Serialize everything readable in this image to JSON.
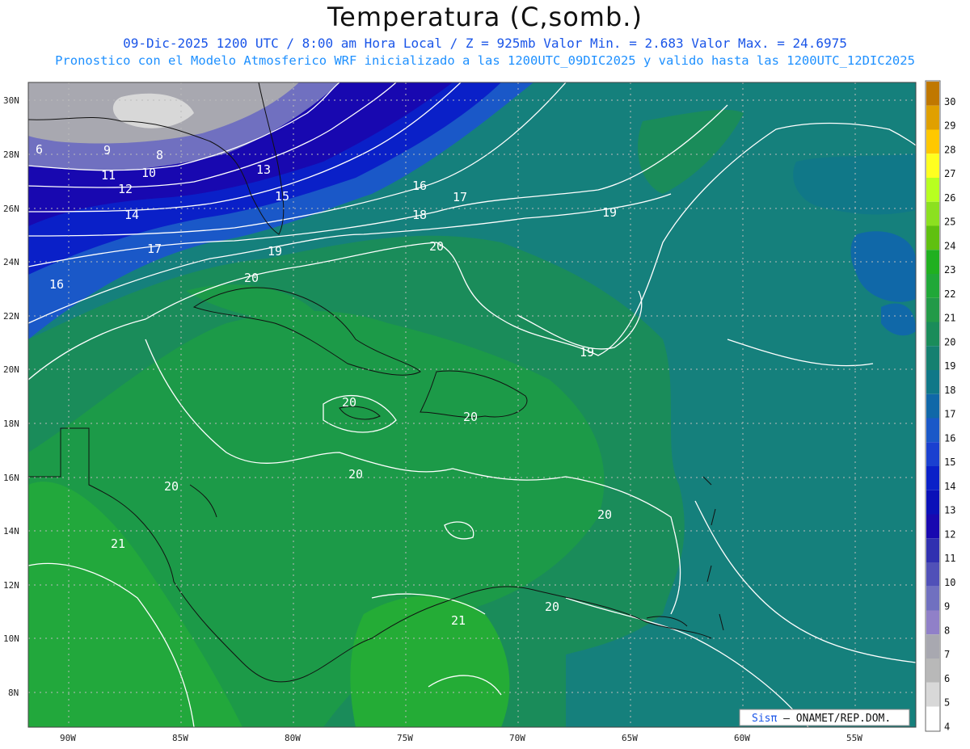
{
  "header": {
    "title": "Temperatura (C,somb.)",
    "date_line": "09-Dic-2025   1200 UTC / 8:00 am Hora Local / Z = 925mb      Valor Min. = 2.683  Valor Max. = 24.6975",
    "model_line": "Pronostico con el Modelo Atmosferico WRF inicializado a las 1200UTC_09DIC2025 y valido hasta las  1200UTC_12DIC2025"
  },
  "map": {
    "lat_labels": [
      "30N",
      "28N",
      "26N",
      "24N",
      "22N",
      "20N",
      "18N",
      "16N",
      "14N",
      "12N",
      "10N",
      "8N"
    ],
    "lon_labels": [
      "90W",
      "85W",
      "80W",
      "75W",
      "70W",
      "65W",
      "60W",
      "55W"
    ],
    "contour_labels": [
      "6",
      "9",
      "8",
      "11",
      "10",
      "12",
      "13",
      "15",
      "14",
      "16",
      "17",
      "18",
      "19",
      "17",
      "19",
      "16",
      "20",
      "20",
      "20",
      "19",
      "20",
      "20",
      "20",
      "20",
      "21",
      "21",
      "20"
    ],
    "colors": {
      "cold": "#c8c8c8",
      "purple": "#7b6cc0",
      "deep_blue": "#0a14b8",
      "blue": "#1f5ad0",
      "teal": "#15807c",
      "green": "#18a34a",
      "bright_green": "#2ab03a"
    }
  },
  "colorbar": {
    "labels": [
      "30",
      "29",
      "28",
      "27",
      "26",
      "25",
      "24",
      "23",
      "22",
      "21",
      "20",
      "19",
      "18",
      "17",
      "16",
      "15",
      "14",
      "13",
      "12",
      "11",
      "10",
      "9",
      "8",
      "7",
      "6",
      "5",
      "4"
    ],
    "colors": [
      "#c07800",
      "#e0a000",
      "#ffc800",
      "#ffff20",
      "#b8ff20",
      "#8ce020",
      "#60c010",
      "#20b020",
      "#20a838",
      "#229a48",
      "#1a8c5a",
      "#158070",
      "#107888",
      "#1068a8",
      "#1a58c8",
      "#1a40d0",
      "#0a20c8",
      "#0a10b8",
      "#1808b0",
      "#3030b0",
      "#5050b8",
      "#7070c0",
      "#9080c8",
      "#a8a8b0",
      "#b8b8b8",
      "#d8d8d8",
      "#ffffff"
    ]
  },
  "credit": {
    "brand": "Sisπ",
    "text": " – ONAMET/REP.DOM."
  }
}
